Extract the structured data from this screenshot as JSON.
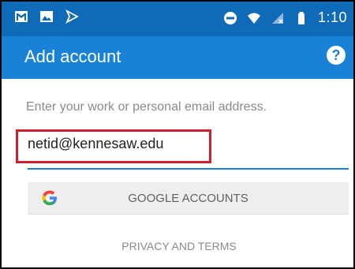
{
  "status_bar": {
    "time": "1:10",
    "left_icons": [
      "gmail-icon",
      "image-icon",
      "play-icon"
    ],
    "right_icons": [
      "dnd-icon",
      "wifi-icon",
      "signal-icon",
      "battery-icon"
    ]
  },
  "app_bar": {
    "title": "Add account",
    "help_icon": "help-icon"
  },
  "form": {
    "prompt": "Enter your work or personal email address.",
    "email_value": "netid@kennesaw.edu"
  },
  "google_button": {
    "label": "GOOGLE ACCOUNTS",
    "icon": "google-icon"
  },
  "privacy_link": "PRIVACY AND TERMS",
  "colors": {
    "status_bar": "#0f6ab8",
    "app_bar": "#1a82d6",
    "highlight": "#c8202d",
    "underline": "#1a82d6"
  }
}
